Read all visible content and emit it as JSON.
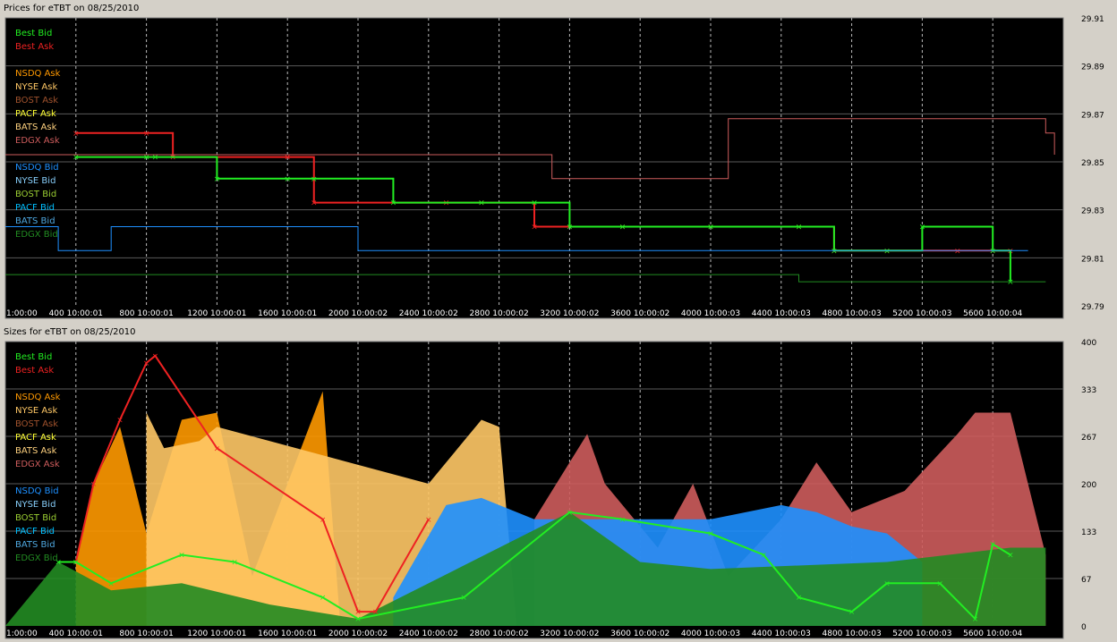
{
  "colors": {
    "plot_bg": "#000000",
    "panel_bg": "#d4d0c8",
    "gridline": "#5a5a5a",
    "vgrid": "#bbbbbb",
    "tick_text": "#ffffff",
    "best_bid": "#22ee22",
    "best_ask": "#ee2222",
    "nsdq_ask": "#ff9900",
    "nyse_ask": "#ffc866",
    "bost_ask": "#a0522d",
    "pacf_ask": "#ffff33",
    "bats_ask": "#ffd27f",
    "edgx_ask": "#cd5c5c",
    "nsdq_bid": "#1e90ff",
    "nyse_bid": "#87cefa",
    "bost_bid": "#9acd32",
    "pacf_bid": "#00bfff",
    "bats_bid": "#4fa8e0",
    "edgx_bid": "#228b22"
  },
  "chart_data": [
    {
      "type": "line",
      "title": "Prices for  eTBT  on  08/25/2010",
      "x_tick_labels": [
        "1:00:00",
        "400 10:00:01",
        "800 10:00:01",
        "1200 10:00:01",
        "1600 10:00:01",
        "2000 10:00:02",
        "2400 10:00:02",
        "2800 10:00:02",
        "3200 10:00:02",
        "3600 10:00:02",
        "4000 10:00:03",
        "4400 10:00:03",
        "4800 10:00:03",
        "5200 10:00:03",
        "5600 10:00:04"
      ],
      "x_tick_values": [
        0,
        400,
        800,
        1200,
        1600,
        2000,
        2400,
        2800,
        3200,
        3600,
        4000,
        4400,
        4800,
        5200,
        5600
      ],
      "xlim": [
        0,
        6000
      ],
      "y_tick_labels": [
        "29.91",
        "29.89",
        "29.87",
        "29.85",
        "29.83",
        "29.81",
        "29.79"
      ],
      "ylim": [
        29.79,
        29.91
      ],
      "grid": true,
      "legend": [
        "Best Bid",
        "Best Ask",
        "NSDQ Ask",
        "NYSE Ask",
        "BOST Ask",
        "PACF Ask",
        "BATS Ask",
        "EDGX Ask",
        "NSDQ Bid",
        "NYSE Bid",
        "BOST Bid",
        "PACF Bid",
        "BATS Bid",
        "EDGX Bid"
      ],
      "legend_position": "top-left",
      "series": [
        {
          "name": "Best Ask",
          "x": [
            400,
            800,
            950,
            1600,
            1750,
            2500,
            2700,
            3000,
            3200,
            3500,
            4000,
            4500,
            4700,
            5000,
            5400,
            5600,
            5700
          ],
          "values": [
            29.862,
            29.862,
            29.852,
            29.852,
            29.833,
            29.833,
            29.833,
            29.823,
            29.823,
            29.823,
            29.823,
            29.823,
            29.813,
            29.813,
            29.813,
            29.813,
            29.813
          ]
        },
        {
          "name": "Best Bid",
          "x": [
            400,
            800,
            850,
            1200,
            1600,
            1750,
            2200,
            2700,
            3000,
            3200,
            3500,
            4000,
            4500,
            4700,
            5000,
            5200,
            5600,
            5700
          ],
          "values": [
            29.852,
            29.852,
            29.852,
            29.843,
            29.843,
            29.843,
            29.833,
            29.833,
            29.833,
            29.823,
            29.823,
            29.823,
            29.823,
            29.813,
            29.813,
            29.823,
            29.813,
            29.8
          ]
        },
        {
          "name": "EDGX Ask",
          "x": [
            0,
            900,
            1600,
            3100,
            3100,
            4000,
            4100,
            5900,
            5950
          ],
          "values": [
            29.853,
            29.853,
            29.853,
            29.853,
            29.843,
            29.843,
            29.868,
            29.862,
            29.853
          ]
        },
        {
          "name": "NSDQ Bid",
          "x": [
            0,
            300,
            600,
            1000,
            1500,
            2000,
            2200,
            2600,
            3200,
            4500,
            5000,
            5600,
            5800
          ],
          "values": [
            29.823,
            29.813,
            29.823,
            29.823,
            29.823,
            29.813,
            29.813,
            29.813,
            29.813,
            29.813,
            29.813,
            29.813,
            29.813
          ]
        },
        {
          "name": "EDGX Bid",
          "x": [
            0,
            4500,
            4500,
            5900
          ],
          "values": [
            29.803,
            29.803,
            29.8,
            29.8
          ]
        }
      ]
    },
    {
      "type": "area",
      "title": "Sizes for  eTBT  on  08/25/2010",
      "x_tick_labels": [
        "1:00:00",
        "400 10:00:01",
        "800 10:00:01",
        "1200 10:00:01",
        "1600 10:00:01",
        "2000 10:00:02",
        "2400 10:00:02",
        "2800 10:00:02",
        "3200 10:00:02",
        "3600 10:00:02",
        "4000 10:00:03",
        "4400 10:00:03",
        "4800 10:00:03",
        "5200 10:00:03",
        "5600 10:00:04"
      ],
      "x_tick_values": [
        0,
        400,
        800,
        1200,
        1600,
        2000,
        2400,
        2800,
        3200,
        3600,
        4000,
        4400,
        4800,
        5200,
        5600
      ],
      "xlim": [
        0,
        6000
      ],
      "y_tick_labels": [
        "400",
        "333",
        "267",
        "200",
        "133",
        "67",
        "0"
      ],
      "ylim": [
        0,
        400
      ],
      "grid": true,
      "legend": [
        "Best Bid",
        "Best Ask",
        "NSDQ Ask",
        "NYSE Ask",
        "BOST Ask",
        "PACF Ask",
        "BATS Ask",
        "EDGX Ask",
        "NSDQ Bid",
        "NYSE Bid",
        "BOST Bid",
        "PACF Bid",
        "BATS Bid",
        "EDGX Bid"
      ],
      "legend_position": "top-left",
      "series": [
        {
          "name": "NSDQ Ask",
          "x": [
            400,
            500,
            650,
            800,
            1000,
            1200,
            1400,
            1800,
            1900
          ],
          "values": [
            90,
            200,
            280,
            130,
            290,
            300,
            70,
            330,
            0
          ]
        },
        {
          "name": "NYSE Ask",
          "x": [
            800,
            900,
            1100,
            1200,
            2400,
            2600,
            2700,
            2800,
            2900
          ],
          "values": [
            300,
            250,
            260,
            280,
            200,
            260,
            290,
            280,
            0
          ]
        },
        {
          "name": "EDGX Ask",
          "x": [
            3000,
            3300,
            3400,
            3700,
            3900,
            4100,
            4400,
            4600,
            4800,
            5100,
            5400,
            5500,
            5700,
            5900
          ],
          "values": [
            150,
            270,
            200,
            110,
            200,
            70,
            150,
            230,
            160,
            190,
            270,
            300,
            300,
            100
          ]
        },
        {
          "name": "NSDQ Bid",
          "x": [
            2200,
            2500,
            2700,
            3000,
            3600,
            4000,
            4400,
            4600,
            4800,
            5000,
            5200
          ],
          "values": [
            40,
            170,
            180,
            150,
            150,
            150,
            170,
            160,
            140,
            130,
            90
          ]
        },
        {
          "name": "EDGX Bid",
          "x": [
            0,
            300,
            600,
            1000,
            1500,
            2000,
            3200,
            3600,
            4000,
            5000,
            5700,
            5900
          ],
          "values": [
            0,
            90,
            50,
            60,
            30,
            10,
            160,
            90,
            80,
            90,
            110,
            110
          ]
        },
        {
          "name": "Best Ask",
          "x": [
            400,
            500,
            650,
            800,
            850,
            1200,
            1800,
            2000,
            2100,
            2400
          ],
          "values": [
            90,
            200,
            290,
            370,
            380,
            250,
            150,
            20,
            20,
            150
          ]
        },
        {
          "name": "Best Bid",
          "x": [
            300,
            400,
            600,
            1000,
            1300,
            1800,
            2000,
            2600,
            3200,
            3500,
            4000,
            4300,
            4500,
            4800,
            5000,
            5300,
            5500,
            5600,
            5700
          ],
          "values": [
            90,
            90,
            60,
            100,
            90,
            40,
            10,
            40,
            160,
            150,
            130,
            100,
            40,
            20,
            60,
            60,
            10,
            115,
            100
          ]
        }
      ]
    }
  ]
}
